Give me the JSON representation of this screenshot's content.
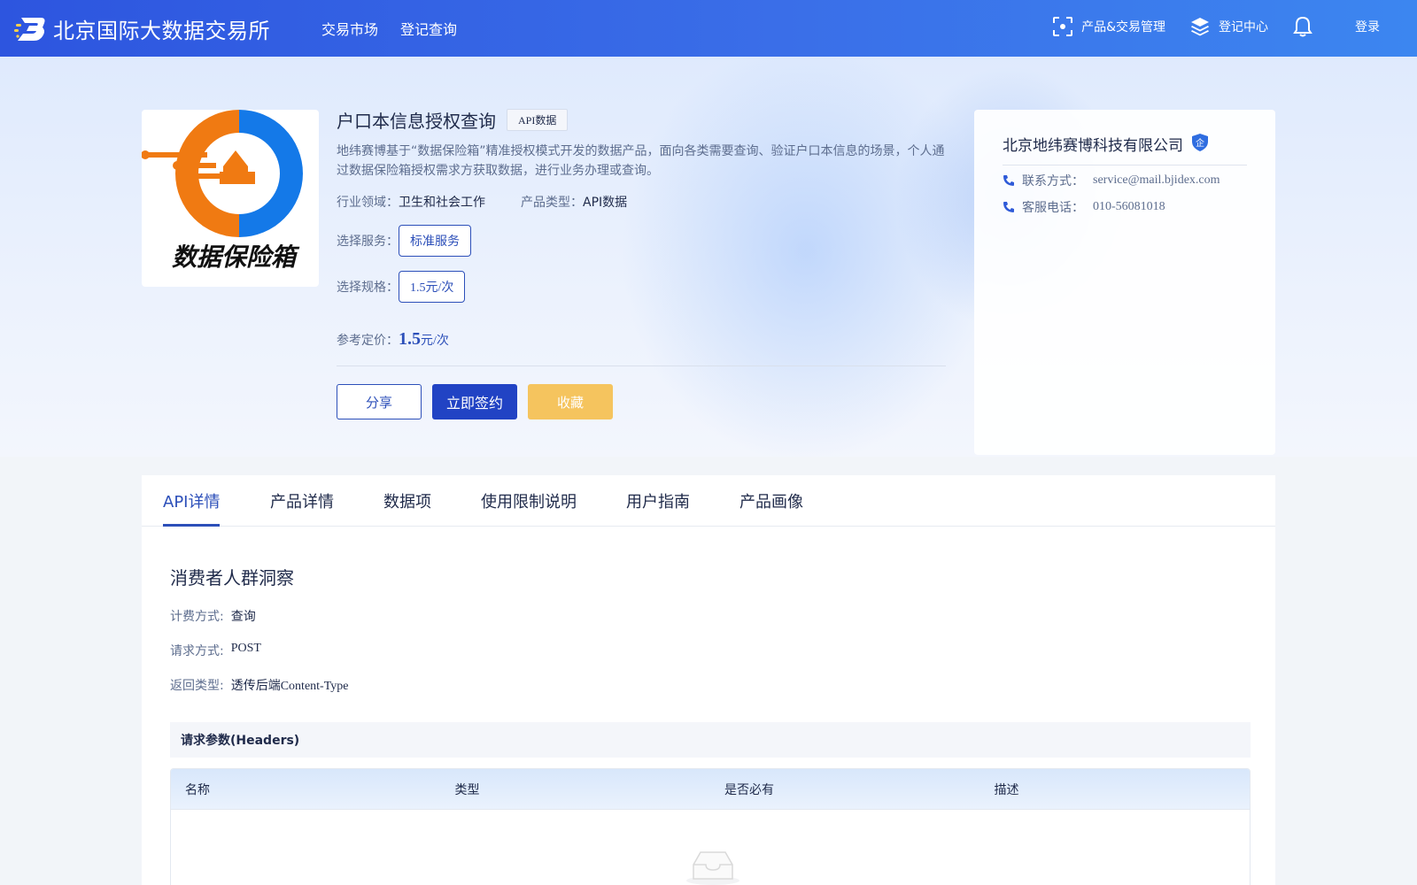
{
  "header": {
    "site_title": "北京国际大数据交易所",
    "nav": [
      "交易市场",
      "登记查询"
    ],
    "product_mgmt": "产品&交易管理",
    "registry_center": "登记中心",
    "login": "登录",
    "icons": [
      "scan-icon",
      "layers-icon",
      "bell-icon"
    ]
  },
  "product": {
    "logo_text": "数据保险箱",
    "title": "户口本信息授权查询",
    "tag": "API数据",
    "description": "地纬赛博基于“数据保险箱”精准授权模式开发的数据产品，面向各类需要查询、验证户口本信息的场景，个人通过数据保险箱授权需求方获取数据，进行业务办理或查询。",
    "industry_label": "行业领域：",
    "industry_value": "卫生和社会工作",
    "type_label": "产品类型：",
    "type_value": "API数据",
    "service_label": "选择服务：",
    "service_option": "标准服务",
    "spec_label": "选择规格：",
    "spec_option": "1.5元/次",
    "price_label": "参考定价：",
    "price_value": "1.5",
    "price_unit": "元/次",
    "share_label": "分享",
    "sign_label": "立即签约",
    "favorite_label": "收藏"
  },
  "company": {
    "name": "北京地纬赛博科技有限公司",
    "badge": "企",
    "contact_label": "联系方式：",
    "contact_value": "service@mail.bjidex.com",
    "phone_label": "客服电话：",
    "phone_value": "010-56081018"
  },
  "tabs": [
    "API详情",
    "产品详情",
    "数据项",
    "使用限制说明",
    "用户指南",
    "产品画像"
  ],
  "active_tab": "API详情",
  "api": {
    "section_title": "消费者人群洞察",
    "billing_label": "计费方式:",
    "billing_value": "查询",
    "method_label": "请求方式:",
    "method_value": "POST",
    "return_label": "返回类型:",
    "return_value": "透传后端Content-Type",
    "params_header": "请求参数(Headers)",
    "columns": [
      "名称",
      "类型",
      "是否必有",
      "描述"
    ]
  },
  "colors": {
    "brand_blue": "#2c4fb9",
    "topbar": "#3a6ee8",
    "favorite": "#f5c45e",
    "logo_orange": "#f07a12",
    "logo_blue": "#1479e8"
  }
}
